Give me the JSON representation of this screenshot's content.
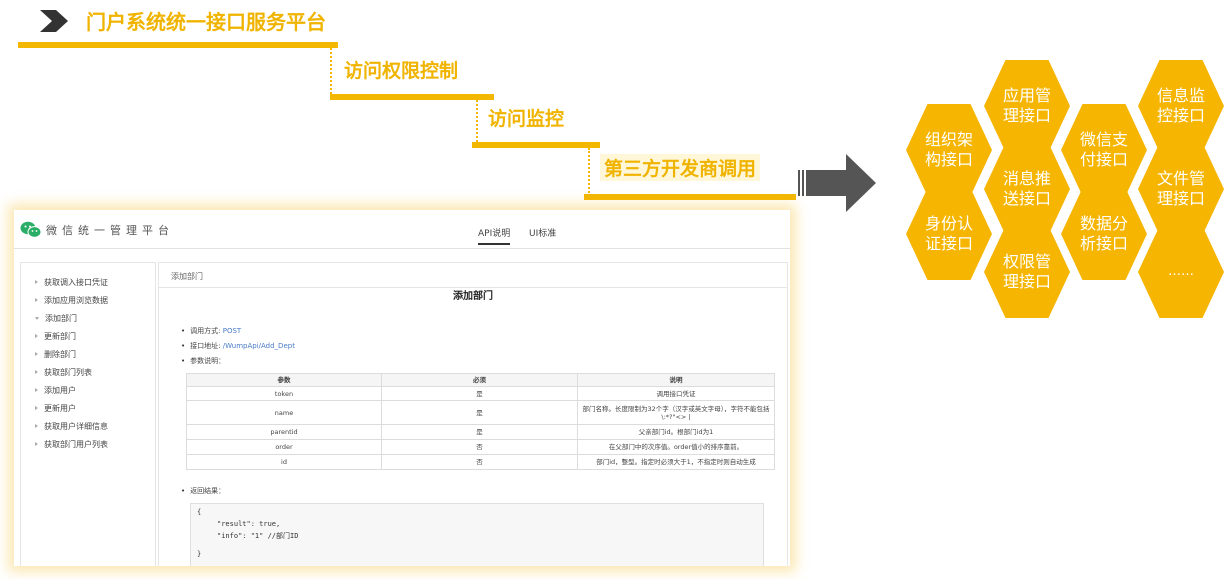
{
  "diagram": {
    "title": "门户系统统一接口服务平台",
    "steps": [
      "访问权限控制",
      "访问监控",
      "第三方开发商调用"
    ],
    "accent_color": "#f3b700",
    "hexagons": [
      {
        "id": "h1",
        "label": "组织架构接口"
      },
      {
        "id": "h2",
        "label": "应用管理接口"
      },
      {
        "id": "h3",
        "label": "消息推送接口"
      },
      {
        "id": "h4",
        "label": "身份认证接口"
      },
      {
        "id": "h5",
        "label": "权限管理接口"
      },
      {
        "id": "h6",
        "label": "微信支付接口"
      },
      {
        "id": "h7",
        "label": "数据分析接口"
      },
      {
        "id": "h8",
        "label": "信息监控接口"
      },
      {
        "id": "h9",
        "label": "文件管理接口"
      },
      {
        "id": "h10",
        "label": "……"
      }
    ]
  },
  "screenshot": {
    "brand": "微信统一管理平台",
    "tabs": [
      "API说明",
      "UI标准"
    ],
    "active_tab": "API说明",
    "sidebar": [
      "获取调入接口凭证",
      "添加应用浏览数据",
      "添加部门",
      "更新部门",
      "删除部门",
      "获取部门列表",
      "添加用户",
      "更新用户",
      "获取用户详细信息",
      "获取部门用户列表"
    ],
    "breadcrumb": "添加部门",
    "doc_title": "添加部门",
    "method_label": "调用方式:",
    "method_value": "POST",
    "url_label": "接口地址:",
    "url_value": "/WumpApi/Add_Dept",
    "params_label": "参数说明：",
    "table": {
      "headers": [
        "参数",
        "必须",
        "说明"
      ],
      "rows": [
        [
          "token",
          "是",
          "调用接口凭证"
        ],
        [
          "name",
          "是",
          "部门名称。长度限制为32个字（汉字或英文字母），字符不能包括\\:*?\"<> |"
        ],
        [
          "parentid",
          "是",
          "父亲部门id。根部门id为1"
        ],
        [
          "order",
          "否",
          "在父部门中的次序值。order值小的排序靠前。"
        ],
        [
          "id",
          "否",
          "部门id，整型。指定时必须大于1，不指定时则自动生成"
        ]
      ]
    },
    "result_label": "返回结果：",
    "code": [
      "{",
      "\"result\": true,",
      "\"info\": \"1\" //部门ID",
      "}"
    ]
  }
}
